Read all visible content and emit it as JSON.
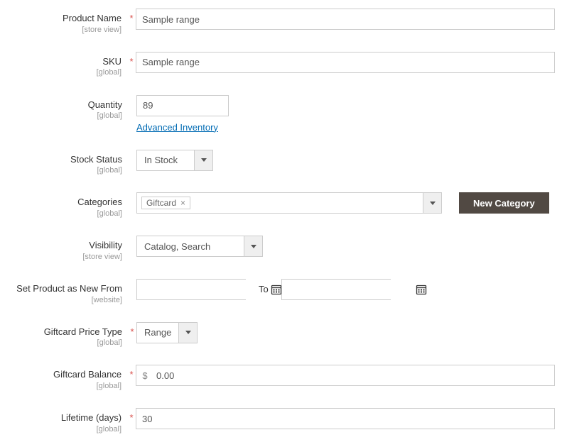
{
  "fields": {
    "productName": {
      "label": "Product Name",
      "scope": "[store view]",
      "value": "Sample range"
    },
    "sku": {
      "label": "SKU",
      "scope": "[global]",
      "value": "Sample range"
    },
    "quantity": {
      "label": "Quantity",
      "scope": "[global]",
      "value": "89",
      "link": "Advanced Inventory"
    },
    "stockStatus": {
      "label": "Stock Status",
      "scope": "[global]",
      "value": "In Stock"
    },
    "categories": {
      "label": "Categories",
      "scope": "[global]",
      "tag": "Giftcard",
      "newBtn": "New Category"
    },
    "visibility": {
      "label": "Visibility",
      "scope": "[store view]",
      "value": "Catalog, Search"
    },
    "newFrom": {
      "label": "Set Product as New From",
      "scope": "[website]",
      "to": "To"
    },
    "priceType": {
      "label": "Giftcard Price Type",
      "scope": "[global]",
      "value": "Range"
    },
    "balance": {
      "label": "Giftcard Balance",
      "scope": "[global]",
      "symbol": "$",
      "value": "0.00"
    },
    "lifetime": {
      "label": "Lifetime (days)",
      "scope": "[global]",
      "value": "30"
    }
  }
}
